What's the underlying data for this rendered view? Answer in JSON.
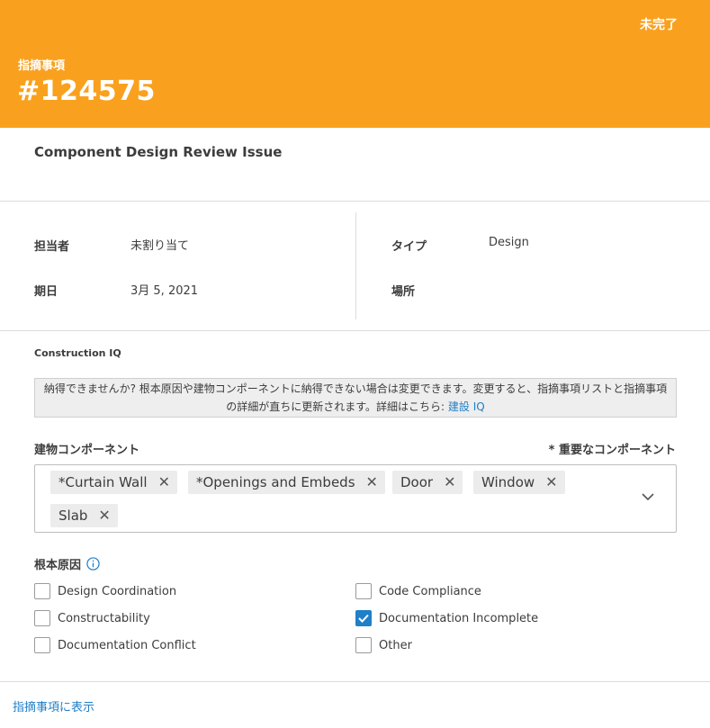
{
  "header": {
    "status": "未完了",
    "kind": "指摘事項",
    "number": "#124575",
    "bg_color": "#f9a11e"
  },
  "issue_title": "Component Design Review Issue",
  "fields": {
    "assignee_label": "担当者",
    "assignee_value": "未割り当て",
    "date_label": "期日",
    "date_value": "3月 5, 2021",
    "type_label": "タイプ",
    "type_value": "Design",
    "location_label": "場所"
  },
  "construction_iq": {
    "title": "Construction IQ",
    "notice_text": "納得できませんか? 根本原因や建物コンポーネントに納得できない場合は変更できます。変更すると、指摘事項リストと指摘事項の詳細が直ちに更新されます。詳細はこちら: ",
    "notice_link": "建設 IQ",
    "link_color": "#1f7fc8"
  },
  "components": {
    "label": "建物コンポーネント",
    "note": "* 重要なコンポーネント",
    "chips": [
      "*Curtain Wall",
      "*Openings and Embeds",
      "Door",
      "Window",
      "Slab"
    ],
    "remove_icon": "close-icon",
    "dropdown_icon": "chevron-down-icon"
  },
  "root_cause": {
    "label": "根本原因",
    "info_icon": "info-icon",
    "options": [
      {
        "label": "Design Coordination",
        "checked": false
      },
      {
        "label": "Constructability",
        "checked": false
      },
      {
        "label": "Documentation Conflict",
        "checked": false
      },
      {
        "label": "Code Compliance",
        "checked": false
      },
      {
        "label": "Documentation Incomplete",
        "checked": true
      },
      {
        "label": "Other",
        "checked": false
      }
    ]
  },
  "footer_link": "指摘事項に表示"
}
